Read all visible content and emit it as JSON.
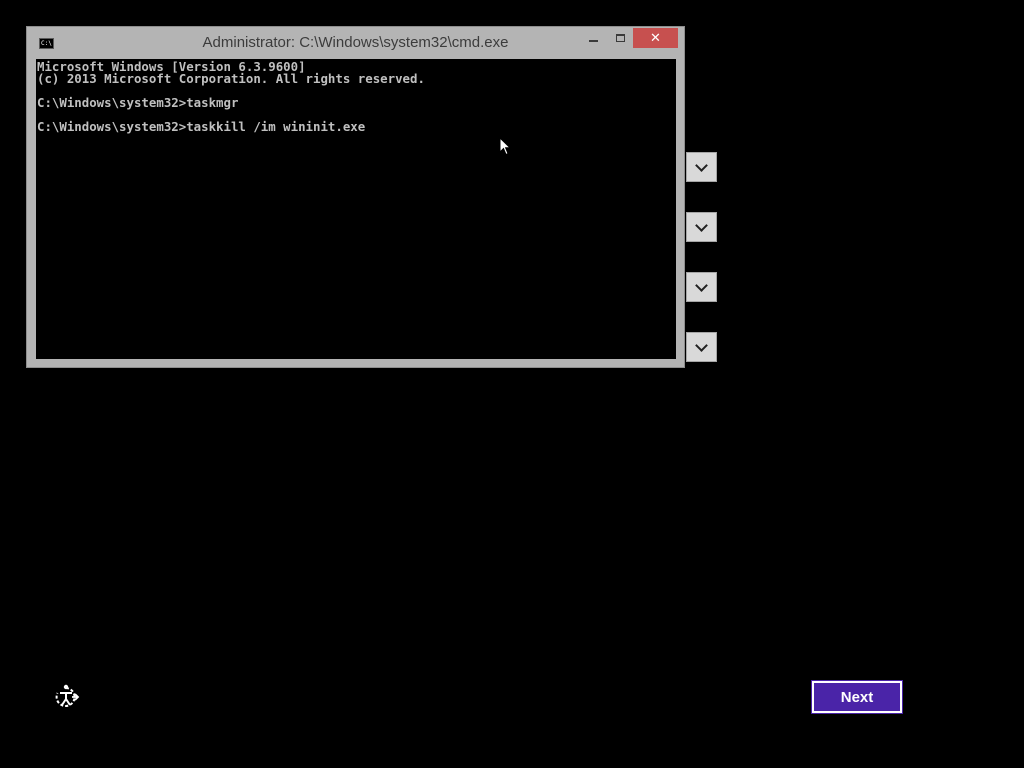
{
  "window": {
    "title": "Administrator: C:\\Windows\\system32\\cmd.exe",
    "app_icon_text": "C:\\",
    "controls": {
      "minimize": "minimize",
      "maximize": "maximize",
      "close": "✕"
    }
  },
  "console": {
    "lines": [
      "Microsoft Windows [Version 6.3.9600]",
      "(c) 2013 Microsoft Corporation. All rights reserved.",
      "",
      "C:\\Windows\\system32>taskmgr",
      "",
      "C:\\Windows\\system32>taskkill /im wininit.exe"
    ]
  },
  "dropdowns": [
    {
      "icon": "chevron-down-icon"
    },
    {
      "icon": "chevron-down-icon"
    },
    {
      "icon": "chevron-down-icon"
    },
    {
      "icon": "chevron-down-icon"
    }
  ],
  "footer": {
    "ease_of_access_icon": "ease-of-access-icon",
    "next_label": "Next"
  },
  "colors": {
    "background": "#000000",
    "window_chrome": "#b4b4b4",
    "close_button": "#c7504f",
    "console_text": "#c0c0c0",
    "next_button": "#4a24a8"
  }
}
